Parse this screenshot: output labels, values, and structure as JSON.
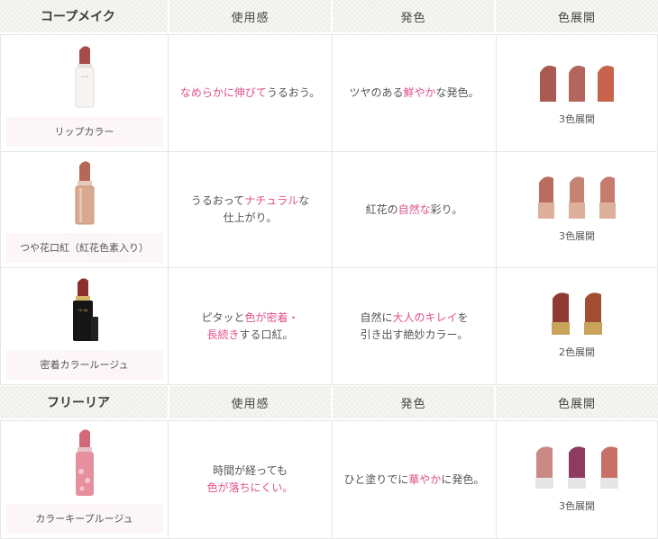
{
  "brands": [
    {
      "name": "コープメイク",
      "headers": {
        "feel": "使用感",
        "color": "発色",
        "range": "色展開"
      },
      "products": [
        {
          "name": "リップカラー",
          "feel": [
            "なめらかに伸びて",
            "うるおう。"
          ],
          "color_text": [
            "ツヤのある",
            "鮮やか",
            "な発色。"
          ],
          "range": "3色展開",
          "shade_colors": [
            "#a95a52",
            "#b4655e",
            "#c9624a"
          ],
          "body_color": "#a74c4c"
        },
        {
          "name": "つや花口紅（紅花色素入り）",
          "feel_line1": [
            "うるおって",
            "ナチュラル",
            "な"
          ],
          "feel_line2": "仕上がり。",
          "color_text": [
            "紅花の",
            "自然な",
            "彩り。"
          ],
          "range": "3色展開",
          "shade_colors": [
            "#b86d5e",
            "#c48373",
            "#c57b6e"
          ],
          "body_color": "#b56856"
        },
        {
          "name": "密着カラールージュ",
          "feel_line1": [
            "ピタッと",
            "色が密着・"
          ],
          "feel_line2": [
            "長続き",
            "する口紅。"
          ],
          "color_line1": [
            "自然に",
            "大人のキレイ",
            "を"
          ],
          "color_line2": "引き出す絶妙カラー。",
          "range": "2色展開",
          "shade_colors": [
            "#8f3a33",
            "#a14e35"
          ],
          "body_color": "#8a2f2c"
        }
      ]
    },
    {
      "name": "フリーリア",
      "headers": {
        "feel": "使用感",
        "color": "発色",
        "range": "色展開"
      },
      "products": [
        {
          "name": "カラーキープルージュ",
          "feel_line1": "時間が経っても",
          "feel_line2": "色が落ちにくい。",
          "color_text": [
            "ひと塗りでに",
            "華やか",
            "に発色。"
          ],
          "range": "3色展開",
          "shade_colors": [
            "#c98a86",
            "#8e3b60",
            "#c87067"
          ],
          "body_color": "#d06a7a"
        }
      ]
    }
  ]
}
